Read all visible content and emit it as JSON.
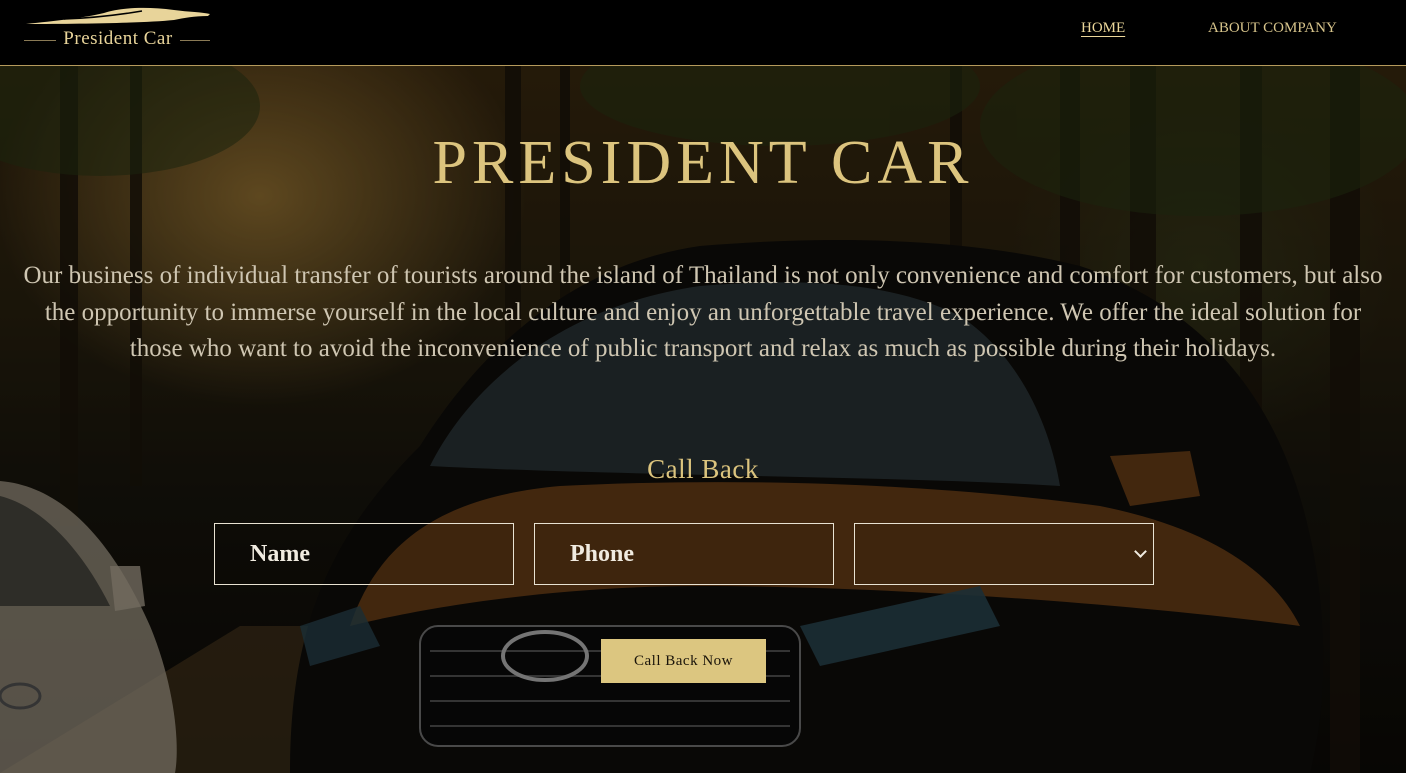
{
  "header": {
    "logo_text": "President Car",
    "nav": {
      "home": "HOME",
      "about": "ABOUT COMPANY"
    }
  },
  "hero": {
    "title": "PRESIDENT CAR",
    "description": "Our business of individual transfer of tourists around the island of Thailand is not only convenience and comfort for customers, but also the opportunity to immerse yourself in the local culture and enjoy an unforgettable travel experience. We offer the ideal solution for those who want to avoid the inconvenience of public transport and relax as much as possible during their holidays."
  },
  "form": {
    "title": "Call Back",
    "name_placeholder": "Name",
    "phone_placeholder": "Phone",
    "select_value": "",
    "submit_label": "Call Back Now"
  },
  "colors": {
    "accent_gold": "#dcc47e",
    "button_gold": "#dcc680",
    "header_bg": "#000000"
  },
  "icons": {
    "logo": "car-silhouette-logo",
    "select": "chevron-down-icon"
  }
}
